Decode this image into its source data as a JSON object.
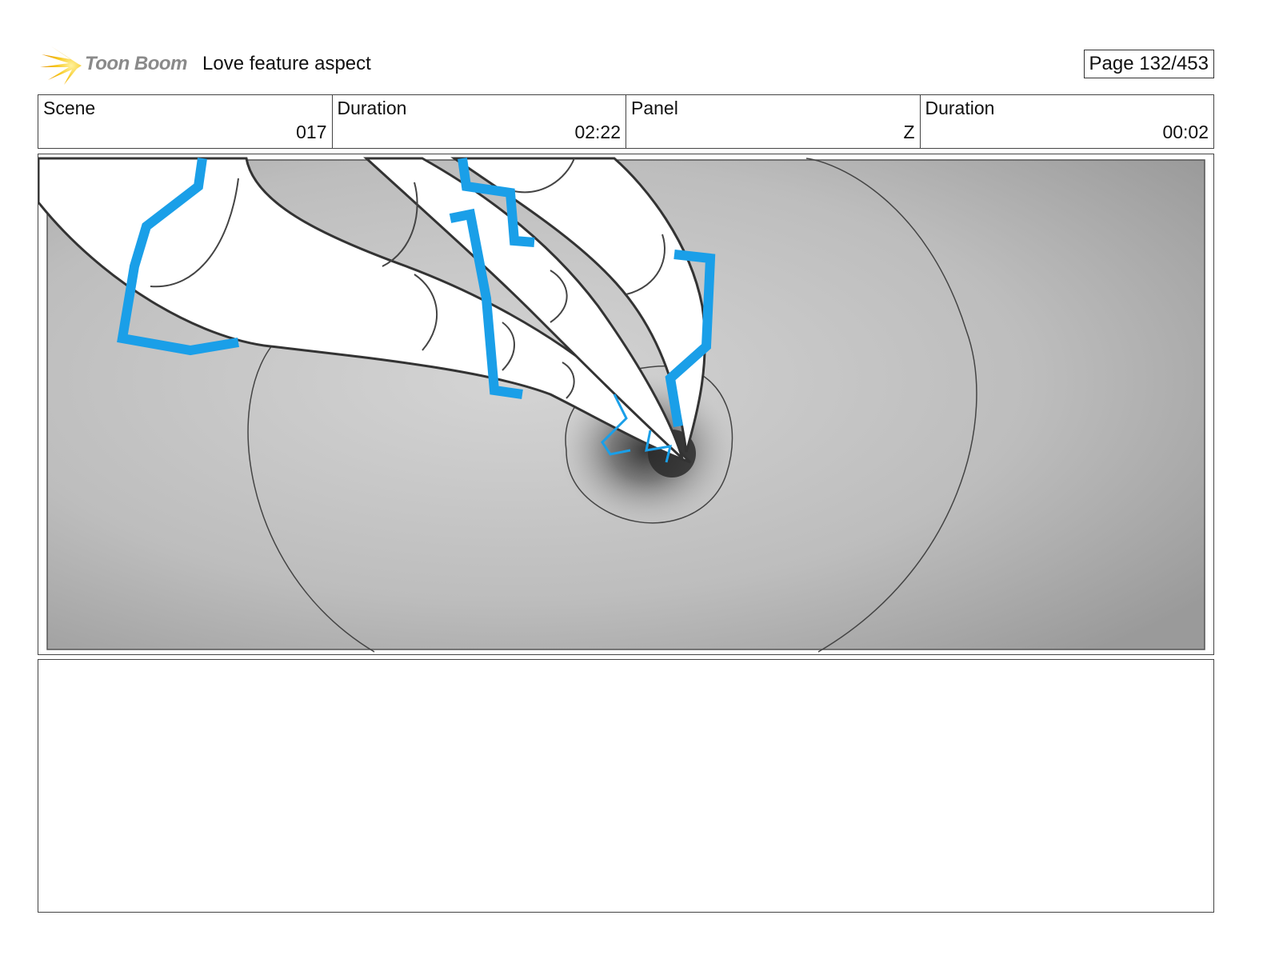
{
  "header": {
    "logo_text": "Toon Boom",
    "project_title": "Love feature aspect",
    "page_label": "Page 132/453"
  },
  "info": {
    "scene_label": "Scene",
    "scene_value": "017",
    "scene_duration_label": "Duration",
    "scene_duration_value": "02:22",
    "panel_label": "Panel",
    "panel_value": "Z",
    "panel_duration_label": "Duration",
    "panel_duration_value": "00:02"
  },
  "panel_image": {
    "accent_color": "#1a9fe8",
    "background_tone": "#b8b8b8"
  },
  "notes": {
    "text": ""
  }
}
